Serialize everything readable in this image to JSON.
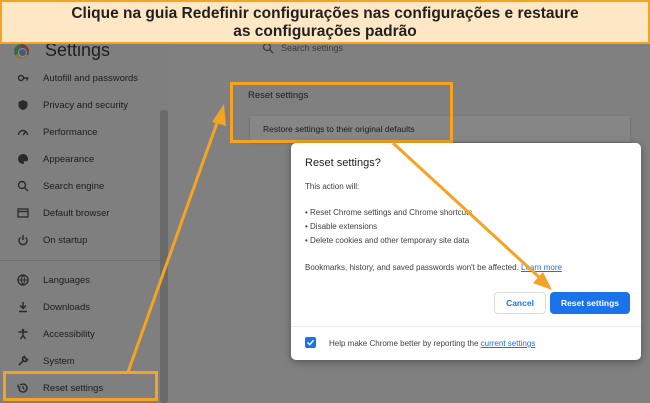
{
  "banner": {
    "line1": "Clique na guia Redefinir configurações nas configurações e restaure",
    "line2": "as configurações padrão"
  },
  "header": {
    "title": "Settings",
    "search_placeholder": "Search settings",
    "logo_icon": "chrome-logo"
  },
  "sidebar": {
    "items": [
      {
        "label": "Autofill and passwords",
        "icon": "key-icon"
      },
      {
        "label": "Privacy and security",
        "icon": "shield-icon"
      },
      {
        "label": "Performance",
        "icon": "speedometer-icon"
      },
      {
        "label": "Appearance",
        "icon": "palette-icon"
      },
      {
        "label": "Search engine",
        "icon": "search-icon"
      },
      {
        "label": "Default browser",
        "icon": "browser-icon"
      },
      {
        "label": "On startup",
        "icon": "power-icon"
      },
      {
        "label": "Languages",
        "icon": "globe-icon"
      },
      {
        "label": "Downloads",
        "icon": "download-icon"
      },
      {
        "label": "Accessibility",
        "icon": "accessibility-icon"
      },
      {
        "label": "System",
        "icon": "wrench-icon"
      },
      {
        "label": "Reset settings",
        "icon": "history-icon"
      }
    ]
  },
  "main": {
    "section_title": "Reset settings",
    "row_label": "Restore settings to their original defaults"
  },
  "dialog": {
    "title": "Reset settings?",
    "intro": "This action will:",
    "bullets": [
      "• Reset Chrome settings and Chrome shortcuts",
      "• Disable extensions",
      "• Delete cookies and other temporary site data"
    ],
    "note": "Bookmarks, history, and saved passwords won't be affected.",
    "learn_more": "Learn more",
    "cancel_label": "Cancel",
    "reset_label": "Reset settings",
    "footer_text": "Help make Chrome better by reporting the",
    "footer_link": "current settings",
    "checkbox_checked": true
  },
  "colors": {
    "highlight": "#f5a323",
    "banner_bg": "#fde7c5",
    "accent": "#1a73e8"
  }
}
